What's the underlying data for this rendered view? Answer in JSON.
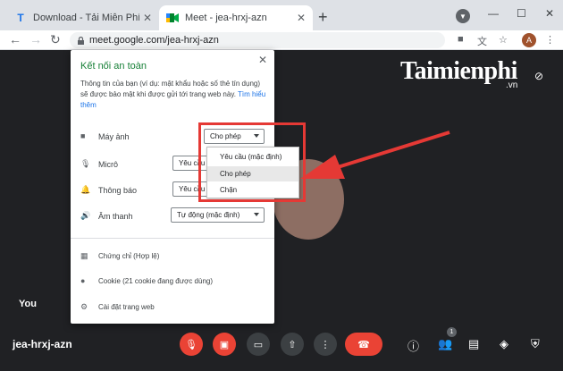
{
  "tabs": [
    {
      "title": "Download - Tải Miễn Phí VN - Ph",
      "favicon": "T",
      "active": false
    },
    {
      "title": "Meet - jea-hrxj-azn",
      "favicon": "meet-logo",
      "active": true
    }
  ],
  "address": {
    "url": "meet.google.com/jea-hrxj-azn",
    "avatar_initial": "A"
  },
  "watermark": {
    "brand": "Taimienphi",
    "sub": ".vn"
  },
  "popup": {
    "title": "Kết nối an toàn",
    "description": "Thông tin của bạn (ví dụ: mật khẩu hoặc số thẻ tín dụng) sẽ được bảo mật khi được gửi tới trang web này.",
    "learn_more": "Tìm hiểu thêm",
    "permissions": [
      {
        "label": "Máy ảnh",
        "icon": "camera-icon",
        "value": "Cho phép"
      },
      {
        "label": "Micrô",
        "icon": "mic-icon",
        "value": "Yêu cầu"
      },
      {
        "label": "Thông báo",
        "icon": "bell-icon",
        "value": "Yêu cầu"
      },
      {
        "label": "Âm thanh",
        "icon": "speaker-icon",
        "value": "Tự động (mặc định)"
      }
    ],
    "links": [
      {
        "label": "Chứng chỉ (Hợp lệ)",
        "icon": "certificate-icon"
      },
      {
        "label": "Cookie (21 cookie đang được dùng)",
        "icon": "cookie-icon"
      },
      {
        "label": "Cài đặt trang web",
        "icon": "gear-icon"
      }
    ]
  },
  "dropdown": {
    "options": [
      "Yêu cầu (mặc định)",
      "Cho phép",
      "Chặn"
    ],
    "highlighted": "Cho phép"
  },
  "meet": {
    "self_label": "You",
    "meeting_code": "jea-hrxj-azn",
    "participant_count": "1"
  },
  "colors": {
    "secure": "#188038",
    "link": "#1a73e8",
    "danger": "#ea4335",
    "annotation": "#e53935"
  }
}
